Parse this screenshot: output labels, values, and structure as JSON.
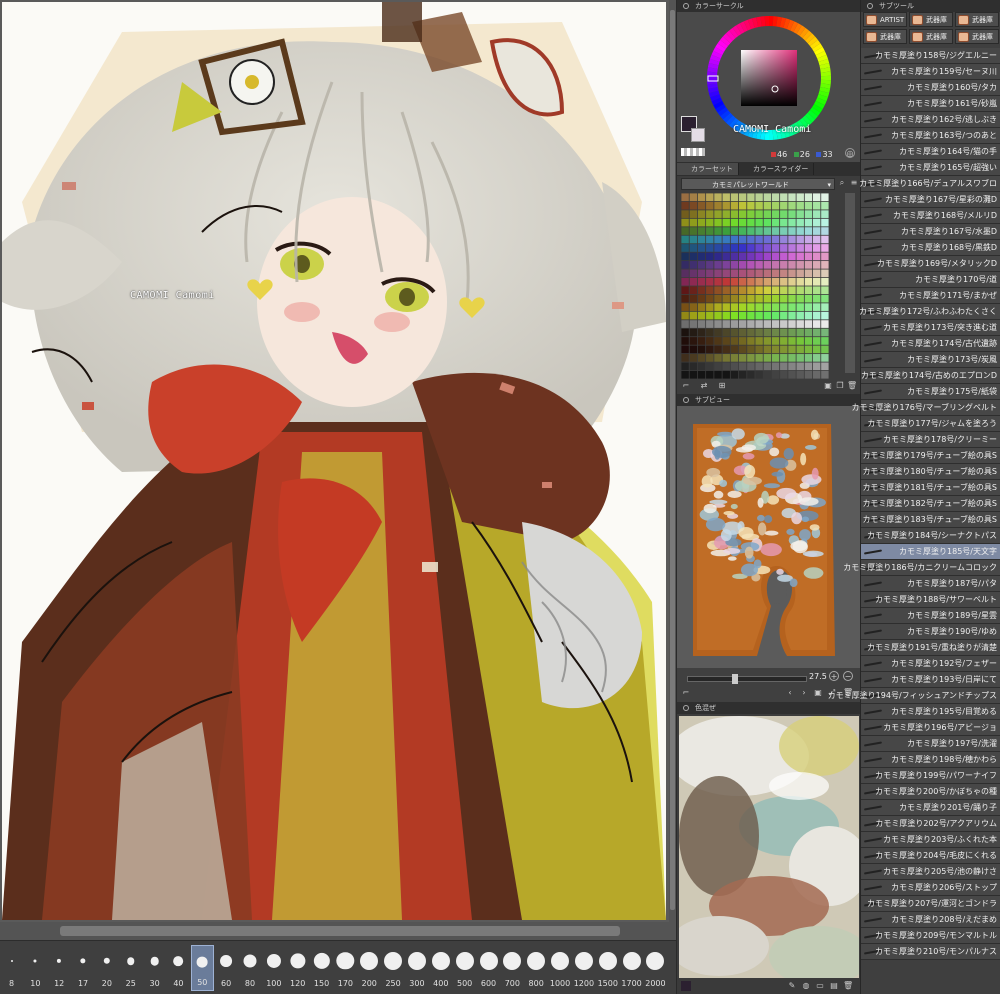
{
  "canvas": {
    "watermark": "CAMOMI Camomi"
  },
  "brush_sizes": {
    "labels": [
      "8",
      "10",
      "12",
      "17",
      "20",
      "25",
      "30",
      "40",
      "50",
      "60",
      "80",
      "100",
      "120",
      "150",
      "170",
      "200",
      "250",
      "300",
      "400",
      "500",
      "600",
      "700",
      "800",
      "1000",
      "1200",
      "1500",
      "1700",
      "2000"
    ],
    "active": "50"
  },
  "color_wheel": {
    "tab_title": "カラーサークル",
    "watermark": "CAMOMI Camomi",
    "rgb": {
      "r": "46",
      "g": "26",
      "b": "33"
    },
    "colors": {
      "main": "#2b2030",
      "sub": "#e4dde6",
      "accent_r": "#d23a3a",
      "accent_g": "#3aa04a",
      "accent_b": "#3a5ad0"
    }
  },
  "color_set": {
    "tabs": [
      "カラーセット",
      "カラースライダー"
    ],
    "selected": "カモミパレットワールド"
  },
  "subview": {
    "tab_title": "サブビュー",
    "zoom": "27.5"
  },
  "navigator": {
    "tab_title": "色混ぜ"
  },
  "sub_tool": {
    "tab_title": "サブツール",
    "groups": [
      "ARTIST",
      "武器庫",
      "武器庫",
      "武器庫",
      "武器庫",
      "武器庫"
    ],
    "items": [
      "カモミ厚塗り158号/ジグエルニー",
      "カモミ厚塗り159号/セーヌ川",
      "カモミ厚塗り160号/タカ",
      "カモミ厚塗り161号/砂嵐",
      "カモミ厚塗り162号/逃しぶき",
      "カモミ厚塗り163号/つのあと",
      "カモミ厚塗り164号/猫の手",
      "カモミ厚塗り165号/超強い",
      "カモミ厚塗り166号/デュアルスワブロ",
      "カモミ厚塗り167号/星彩の灘D",
      "カモミ厚塗り168号/メルリD",
      "カモミ厚塗り167号/水墨D",
      "カモミ厚塗り168号/黒鉄D",
      "カモミ厚塗り169号/メタリックD",
      "カモミ厚塗り170号/道",
      "カモミ厚塗り171号/まかぜ",
      "カモミ厚塗り172号/ふわふわたくさく",
      "カモミ厚塗り173号/突き進む道",
      "カモミ厚塗り174号/古代遺跡",
      "カモミ厚塗り173号/炭風",
      "カモミ厚塗り174号/古めのエプロンD",
      "カモミ厚塗り175号/紙袋",
      "カモミ厚塗り176号/マーブリングペルト",
      "カモミ厚塗り177号/ジャムを塗ろう",
      "カモミ厚塗り178号/クリーミー",
      "カモミ厚塗り179号/チューブ絵の具S",
      "カモミ厚塗り180号/チューブ絵の具S",
      "カモミ厚塗り181号/チューブ絵の具S",
      "カモミ厚塗り182号/チューブ絵の具S",
      "カモミ厚塗り183号/チューブ絵の具S",
      "カモミ厚塗り184号/シーナクトパス",
      "カモミ厚塗り185号/天文字",
      "カモミ厚塗り186号/カニクリームコロック",
      "カモミ厚塗り187号/パタ",
      "カモミ厚塗り188号/サワーベルト",
      "カモミ厚塗り189号/星雲",
      "カモミ厚塗り190号/ゆめ",
      "カモミ厚塗り191号/重ね塗りが清楚",
      "カモミ厚塗り192号/フェザー",
      "カモミ厚塗り193号/日岸にて",
      "カモミ厚塗り194号/フィッシュアンドチップス",
      "カモミ厚塗り195号/目覚める",
      "カモミ厚塗り196号/アビージョ",
      "カモミ厚塗り197号/洗濯",
      "カモミ厚塗り198号/穂かわら",
      "カモミ厚塗り199号/パワーナイフ",
      "カモミ厚塗り200号/かぼちゃの種",
      "カモミ厚塗り201号/踊り子",
      "カモミ厚塗り202号/アクアリウム",
      "カモミ厚塗り203号/ふくれた本",
      "カモミ厚塗り204号/毛皮にくれる",
      "カモミ厚塗り205号/池の静けさ",
      "カモミ厚塗り206号/ストップ",
      "カモミ厚塗り207号/運河とゴンドラ",
      "カモミ厚塗り208号/えだまめ",
      "カモミ厚塗り209号/モンマルトル",
      "カモミ厚塗り210号/モンパルナス"
    ],
    "active_index": 31
  }
}
